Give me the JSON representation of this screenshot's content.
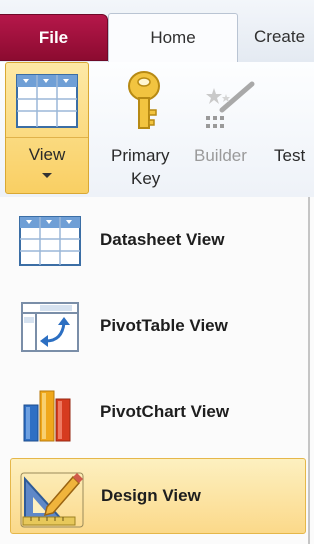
{
  "tabs": {
    "file": "File",
    "home": "Home",
    "create": "Create"
  },
  "ribbon": {
    "view_label": "View",
    "primary_key_line1": "Primary",
    "primary_key_line2": "Key",
    "builder_label": "Builder",
    "test_label": "Test"
  },
  "menu": {
    "items": [
      {
        "label": "Datasheet View",
        "icon": "datasheet-view-icon"
      },
      {
        "label": "PivotTable View",
        "icon": "pivottable-view-icon"
      },
      {
        "label": "PivotChart View",
        "icon": "pivotchart-view-icon"
      },
      {
        "label": "Design View",
        "icon": "design-view-icon",
        "selected": true
      }
    ]
  },
  "colors": {
    "file_tab": "#a3133f",
    "highlight": "#fbd98a",
    "highlight_border": "#e5b74a"
  }
}
